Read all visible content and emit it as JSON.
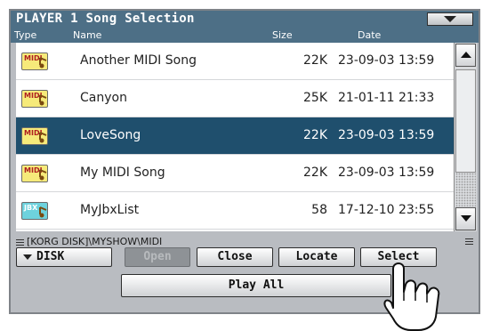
{
  "window": {
    "title": "PLAYER 1 Song Selection"
  },
  "columns": {
    "type": "Type",
    "name": "Name",
    "size": "Size",
    "date": "Date"
  },
  "files": [
    {
      "type_label": "MIDI",
      "type_icon": "midi-file-icon",
      "name": "Another MIDI Song",
      "size": "22K",
      "date": "23-09-03 13:59",
      "selected": false
    },
    {
      "type_label": "MIDI",
      "type_icon": "midi-file-icon",
      "name": "Canyon",
      "size": "25K",
      "date": "21-01-11 21:33",
      "selected": false
    },
    {
      "type_label": "MIDI",
      "type_icon": "midi-file-icon",
      "name": "LoveSong",
      "size": "22K",
      "date": "23-09-03 13:59",
      "selected": true
    },
    {
      "type_label": "MIDI",
      "type_icon": "midi-file-icon",
      "name": "My MIDI Song",
      "size": "22K",
      "date": "23-09-03 13:59",
      "selected": false
    },
    {
      "type_label": "JBX",
      "type_icon": "jbx-file-icon",
      "name": "MyJbxList",
      "size": "58",
      "date": "17-12-10 23:55",
      "selected": false
    }
  ],
  "path": "[KORG DISK]\\MYSHOW\\MIDI",
  "buttons": {
    "disk": "DISK",
    "open": "Open",
    "close": "Close",
    "locate": "Locate",
    "select": "Select",
    "play_all": "Play All"
  },
  "colors": {
    "titlebar": "#4d6f86",
    "selected_row": "#1f4f6d",
    "panel": "#b9bcc1",
    "midi_icon": "#f6ea7a",
    "jbx_icon": "#6ed2dd"
  }
}
